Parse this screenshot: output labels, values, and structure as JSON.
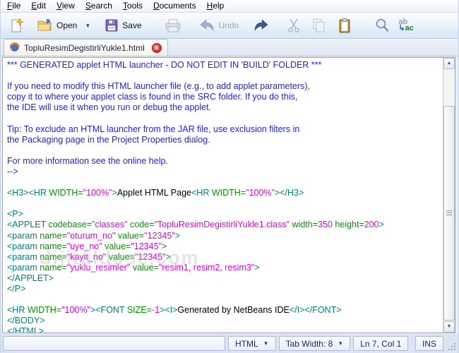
{
  "menu": {
    "items": [
      {
        "label": "File"
      },
      {
        "label": "Edit"
      },
      {
        "label": "View"
      },
      {
        "label": "Search"
      },
      {
        "label": "Tools"
      },
      {
        "label": "Documents"
      },
      {
        "label": "Help"
      }
    ]
  },
  "toolbar": {
    "open_label": "Open",
    "save_label": "Save",
    "undo_label": "Undo",
    "replace_top": "ab",
    "replace_bottom": "ac",
    "icons": [
      "new-file",
      "open-folder",
      "open-dropdown-arrow",
      "save-floppy",
      "printer",
      "undo-arrow",
      "redo-arrow",
      "scissors-cut",
      "copy-pages",
      "paste-clipboard",
      "find-magnifier",
      "replace-ab-ac"
    ]
  },
  "tabs": [
    {
      "title": "TopluResimDegistirliYukle1.html",
      "icon": "firefox-globe",
      "close_icon": "red-circle-x"
    }
  ],
  "editor": {
    "lines": [
      [
        [
          "cm",
          "*** GENERATED applet HTML launcher - DO NOT EDIT IN 'BUILD' FOLDER ***"
        ]
      ],
      [],
      [
        [
          "cm",
          "If you need to modify this HTML launcher file (e.g., to add applet parameters),"
        ]
      ],
      [
        [
          "cm",
          "copy it to where your applet class is found in the SRC folder. If you do this,"
        ]
      ],
      [
        [
          "cm",
          "the IDE will use it when you run or debug the applet."
        ]
      ],
      [],
      [
        [
          "cm",
          "Tip: To exclude an HTML launcher from the JAR file, use exclusion filters in"
        ]
      ],
      [
        [
          "cm",
          "the Packaging page in the Project Properties dialog."
        ]
      ],
      [],
      [
        [
          "cm",
          "For more information see the online help."
        ]
      ],
      [
        [
          "cm",
          "-->"
        ]
      ],
      [],
      [
        [
          "tg",
          "<H3><HR "
        ],
        [
          "at",
          "WIDTH="
        ],
        [
          "vl",
          "\"100%\""
        ],
        [
          "tg",
          ">"
        ],
        [
          "tx",
          "Applet HTML Page"
        ],
        [
          "tg",
          "<HR "
        ],
        [
          "at",
          "WIDTH="
        ],
        [
          "vl",
          "\"100%\""
        ],
        [
          "tg",
          "></H3>"
        ]
      ],
      [],
      [
        [
          "tg",
          "<P>"
        ]
      ],
      [
        [
          "tg",
          "<APPLET "
        ],
        [
          "at",
          "codebase="
        ],
        [
          "vl",
          "\"classes\""
        ],
        [
          "at",
          " code="
        ],
        [
          "vl",
          "\"TopluResimDegistirliYukle1.class\""
        ],
        [
          "at",
          " width="
        ],
        [
          "vl",
          "350"
        ],
        [
          "at",
          " height="
        ],
        [
          "vl",
          "200"
        ],
        [
          "tg",
          ">"
        ]
      ],
      [
        [
          "tg",
          "<param "
        ],
        [
          "at",
          "name="
        ],
        [
          "vl",
          "\"oturum_no\""
        ],
        [
          "at",
          " value="
        ],
        [
          "vl",
          "\"12345\""
        ],
        [
          "tg",
          ">"
        ]
      ],
      [
        [
          "tg",
          "<param "
        ],
        [
          "at",
          "name="
        ],
        [
          "vl",
          "\"uye_no\""
        ],
        [
          "at",
          " value="
        ],
        [
          "vl",
          "\"12345\""
        ],
        [
          "tg",
          ">"
        ]
      ],
      [
        [
          "tg",
          "<param "
        ],
        [
          "at",
          "name="
        ],
        [
          "vl",
          "\"kayit_no\""
        ],
        [
          "at",
          " value="
        ],
        [
          "vl",
          "\"12345\""
        ],
        [
          "tg",
          ">"
        ]
      ],
      [
        [
          "tg",
          "<param "
        ],
        [
          "at",
          "name="
        ],
        [
          "vl",
          "\"yuklu_resimler\""
        ],
        [
          "at",
          " value="
        ],
        [
          "vl",
          "\"resim1, resim2, resim3\""
        ],
        [
          "tg",
          ">"
        ]
      ],
      [
        [
          "tg",
          "</APPLET>"
        ]
      ],
      [
        [
          "tg",
          "</P>"
        ]
      ],
      [],
      [
        [
          "tg",
          "<HR "
        ],
        [
          "at",
          "WIDTH="
        ],
        [
          "vl",
          "\"100%\""
        ],
        [
          "tg",
          "><FONT "
        ],
        [
          "at",
          "SIZE="
        ],
        [
          "vl",
          "-1"
        ],
        [
          "tg",
          "><I>"
        ],
        [
          "tx",
          "Generated by NetBeans IDE"
        ],
        [
          "tg",
          "</I></FONT>"
        ]
      ],
      [
        [
          "tg",
          "</BODY>"
        ]
      ],
      [
        [
          "tg",
          "</HTML>"
        ]
      ]
    ]
  },
  "watermark": {
    "text": "dijitaldose.com"
  },
  "status": {
    "mode": "HTML",
    "tab_width_label": "Tab Width:  8",
    "cursor_position": "Ln 7, Col 1",
    "insert_mode": "INS"
  },
  "colors": {
    "comment": "#2222dd",
    "tag": "#00807a",
    "attr": "#009900",
    "value": "#e400e4",
    "plain": "#000000",
    "tab_close": "#d42a24",
    "status_text": "#202a5e"
  }
}
